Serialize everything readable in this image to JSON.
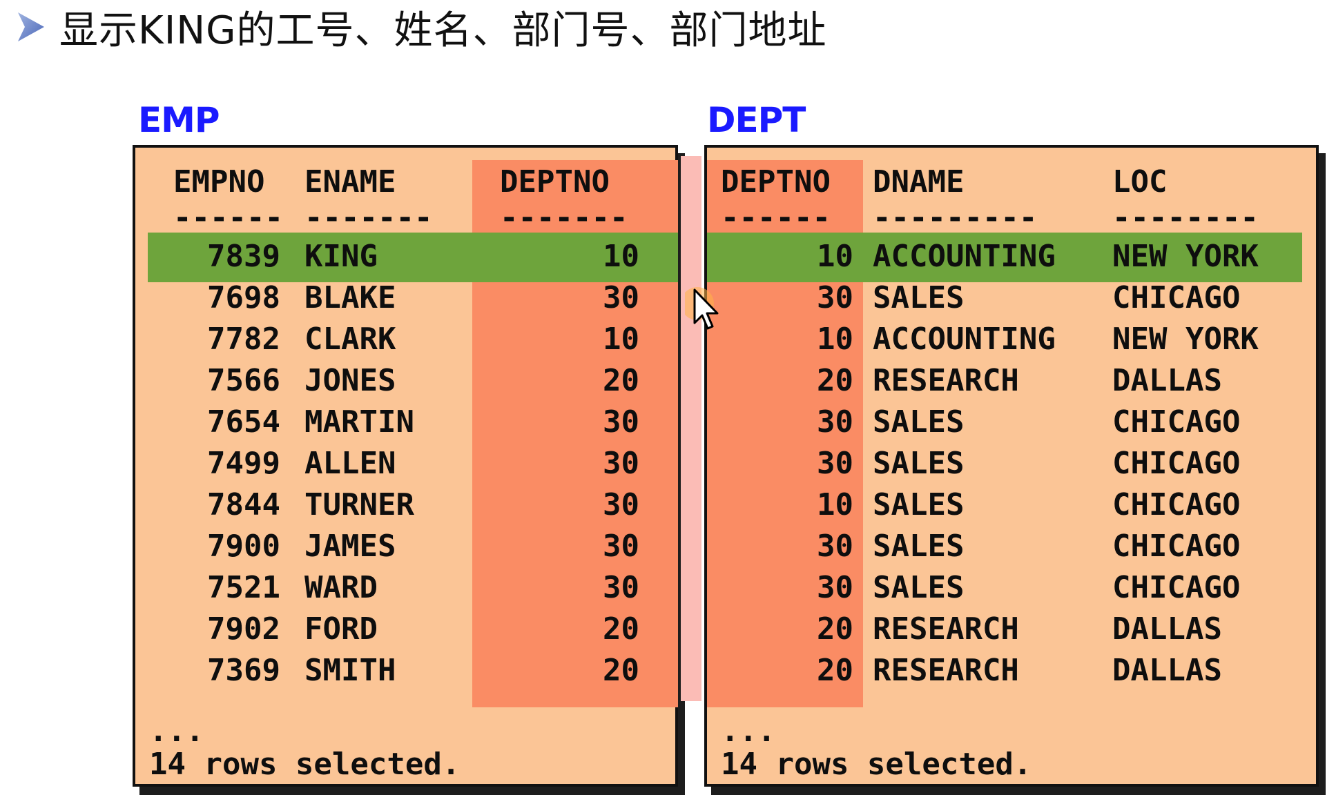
{
  "heading": "显示KING的工号、姓名、部门号、部门地址",
  "emp": {
    "title": "EMP",
    "headers": [
      "EMPNO",
      "ENAME",
      "DEPTNO"
    ],
    "dashes": [
      "------",
      "-------",
      "-------"
    ],
    "rows": [
      [
        "7839",
        "KING",
        "10"
      ],
      [
        "7698",
        "BLAKE",
        "30"
      ],
      [
        "7782",
        "CLARK",
        "10"
      ],
      [
        "7566",
        "JONES",
        "20"
      ],
      [
        "7654",
        "MARTIN",
        "30"
      ],
      [
        "7499",
        "ALLEN",
        "30"
      ],
      [
        "7844",
        "TURNER",
        "30"
      ],
      [
        "7900",
        "JAMES",
        "30"
      ],
      [
        "7521",
        "WARD",
        "30"
      ],
      [
        "7902",
        "FORD",
        "20"
      ],
      [
        "7369",
        "SMITH",
        "20"
      ]
    ],
    "ellipsis": "...",
    "footer": "14 rows selected."
  },
  "dept": {
    "title": "DEPT",
    "headers": [
      "DEPTNO",
      "DNAME",
      "LOC"
    ],
    "dashes": [
      "------",
      "---------",
      "--------"
    ],
    "rows": [
      [
        "10",
        "ACCOUNTING",
        "NEW YORK"
      ],
      [
        "30",
        "SALES",
        "CHICAGO"
      ],
      [
        "10",
        "ACCOUNTING",
        "NEW YORK"
      ],
      [
        "20",
        "RESEARCH",
        "DALLAS"
      ],
      [
        "30",
        "SALES",
        "CHICAGO"
      ],
      [
        "30",
        "SALES",
        "CHICAGO"
      ],
      [
        "10",
        "SALES",
        "CHICAGO"
      ],
      [
        "30",
        "SALES",
        "CHICAGO"
      ],
      [
        "30",
        "SALES",
        "CHICAGO"
      ],
      [
        "20",
        "RESEARCH",
        "DALLAS"
      ],
      [
        "20",
        "RESEARCH",
        "DALLAS"
      ]
    ],
    "ellipsis": "...",
    "footer": "14 rows selected."
  },
  "highlight": {
    "row_color": "#6ea43c",
    "column_color": "#fa8c64",
    "panel_color": "#fbc596",
    "title_color": "#1a1aff"
  }
}
